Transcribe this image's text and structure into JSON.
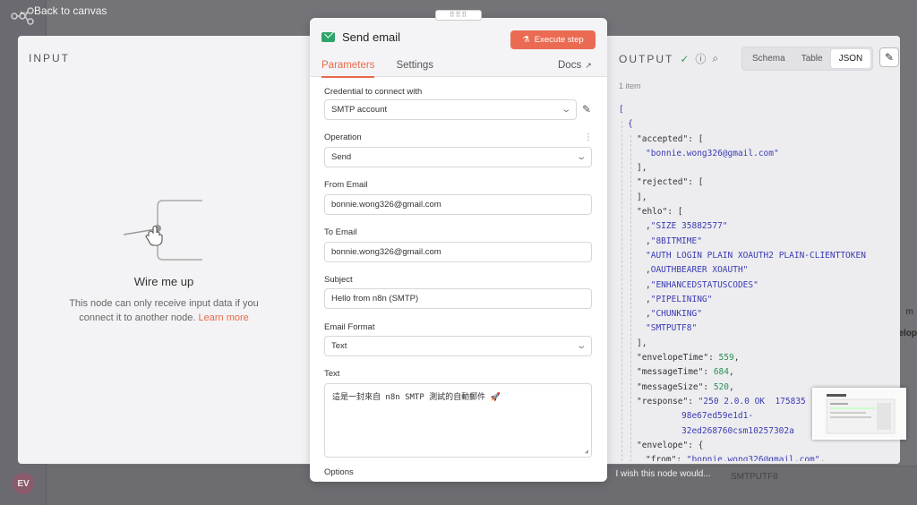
{
  "back_link": "Back to canvas",
  "avatar_initials": "EV",
  "input_panel": {
    "title": "INPUT",
    "wire_title": "Wire me up",
    "wire_desc": "This node can only receive input data if you connect it to another node.",
    "learn_more": "Learn more"
  },
  "node": {
    "title": "Send email",
    "execute_label": "Execute step",
    "tabs": [
      "Parameters",
      "Settings"
    ],
    "docs_label": "Docs",
    "fields": {
      "credential_label": "Credential to connect with",
      "credential_value": "SMTP account",
      "operation_label": "Operation",
      "operation_value": "Send",
      "from_label": "From Email",
      "from_value": "bonnie.wong326@gmail.com",
      "to_label": "To Email",
      "to_value": "bonnie.wong326@gmail.com",
      "subject_label": "Subject",
      "subject_value": "Hello from n8n (SMTP)",
      "format_label": "Email Format",
      "format_value": "Text",
      "text_label": "Text",
      "text_value": "這是一封來自 n8n SMTP 測試的自動郵件 🚀",
      "options_label": "Options"
    }
  },
  "output_panel": {
    "title": "OUTPUT",
    "views": [
      "Schema",
      "Table",
      "JSON"
    ],
    "active_view": "JSON",
    "items_count": "1 item",
    "json_lines": [
      {
        "t": "["
      },
      {
        "t": "{"
      },
      {
        "k": "\"accepted\"",
        "t": ": ["
      },
      {
        "s": "\"bonnie.wong326@gmail.com\""
      },
      {
        "t": "],"
      },
      {
        "k": "\"rejected\"",
        "t": ": ["
      },
      {
        "t": "],"
      },
      {
        "k": "\"ehlo\"",
        "t": ": ["
      },
      {
        "s": "\"SIZE 35882577\"",
        "t": ","
      },
      {
        "s": "\"8BITMIME\"",
        "t": ","
      },
      {
        "s": "\"AUTH LOGIN PLAIN XOAUTH2 PLAIN-CLIENTTOKEN"
      },
      {
        "s": "OAUTHBEARER XOAUTH\"",
        "t": ","
      },
      {
        "s": "\"ENHANCEDSTATUSCODES\"",
        "t": ","
      },
      {
        "s": "\"PIPELINING\"",
        "t": ","
      },
      {
        "s": "\"CHUNKING\"",
        "t": ","
      },
      {
        "s": "\"SMTPUTF8\""
      },
      {
        "t": "],"
      },
      {
        "k": "\"envelopeTime\"",
        "t": ": ",
        "n": "559",
        "t2": ","
      },
      {
        "k": "\"messageTime\"",
        "t": ": ",
        "n": "684",
        "t2": ","
      },
      {
        "k": "\"messageSize\"",
        "t": ": ",
        "n": "520",
        "t2": ","
      },
      {
        "k": "\"response\"",
        "t": ": ",
        "s": "\"250 2.0.0 OK  175835"
      },
      {
        "s": "98e67ed59e1d1-"
      },
      {
        "s": "32ed268760csm1025730​2a"
      },
      {
        "k": "\"envelope\"",
        "t": ": {"
      },
      {
        "k": "\"from\"",
        "t": ": ",
        "s": "\"bonnie.wong326@gmail.com\"",
        "t2": ","
      }
    ]
  },
  "wish_text": "I wish this node would...",
  "bg_texts": {
    "smtputf8": "SMTPUTF8",
    "m": "m",
    "elop": "elop"
  }
}
